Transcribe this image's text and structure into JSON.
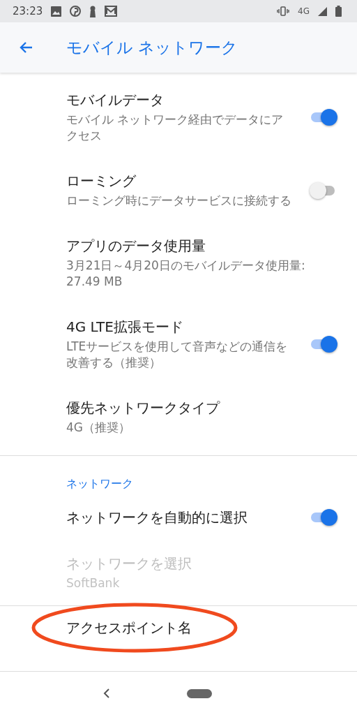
{
  "status_bar": {
    "time": "23:23",
    "network": "4G"
  },
  "app_bar": {
    "title": "モバイル ネットワーク"
  },
  "groups": [
    {
      "items": [
        {
          "kind": "toggle",
          "title": "モバイルデータ",
          "summary": "モバイル ネットワーク経由でデータにアクセス",
          "on": true,
          "disabled": false
        },
        {
          "kind": "toggle",
          "title": "ローミング",
          "summary": "ローミング時にデータサービスに接続する",
          "on": false,
          "disabled": false
        },
        {
          "kind": "plain",
          "title": "アプリのデータ使用量",
          "summary": "3月21日～4月20日のモバイルデータ使用量: 27.49 MB",
          "disabled": false
        },
        {
          "kind": "toggle",
          "title": "4G LTE拡張モード",
          "summary": "LTEサービスを使用して音声などの通信を改善する（推奨）",
          "on": true,
          "disabled": false
        },
        {
          "kind": "plain",
          "title": "優先ネットワークタイプ",
          "summary": "4G（推奨）",
          "disabled": false
        }
      ]
    },
    {
      "header": "ネットワーク",
      "items": [
        {
          "kind": "toggle",
          "title": "ネットワークを自動的に選択",
          "on": true,
          "disabled": false
        },
        {
          "kind": "plain",
          "title": "ネットワークを選択",
          "summary": "SoftBank",
          "disabled": true
        }
      ]
    },
    {
      "items": [
        {
          "kind": "plain",
          "title": "アクセスポイント名",
          "disabled": false,
          "circled": true
        }
      ]
    }
  ]
}
